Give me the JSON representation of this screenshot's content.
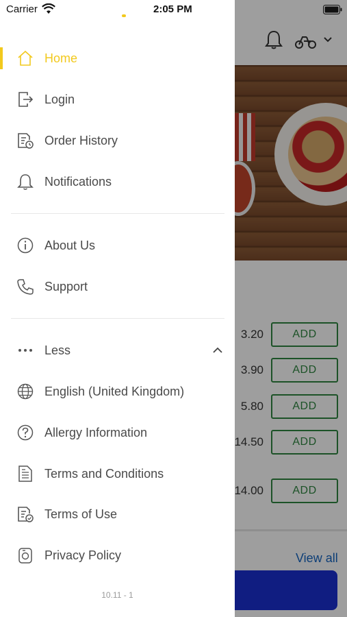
{
  "status_bar": {
    "carrier": "Carrier",
    "time": "2:05 PM"
  },
  "menu": {
    "primary": [
      {
        "label": "Home",
        "icon": "home-icon",
        "active": true
      },
      {
        "label": "Login",
        "icon": "login-icon"
      },
      {
        "label": "Order History",
        "icon": "order-history-icon"
      },
      {
        "label": "Notifications",
        "icon": "bell-icon"
      }
    ],
    "secondary": [
      {
        "label": "About Us",
        "icon": "info-icon"
      },
      {
        "label": "Support",
        "icon": "phone-icon"
      }
    ],
    "more_toggle": {
      "label": "Less",
      "icon": "ellipsis-icon",
      "chevron": "chevron-up-icon"
    },
    "extra": [
      {
        "label": "English (United Kingdom)",
        "icon": "globe-icon"
      },
      {
        "label": "Allergy Information",
        "icon": "question-icon"
      },
      {
        "label": "Terms and Conditions",
        "icon": "document-icon"
      },
      {
        "label": "Terms of Use",
        "icon": "document-check-icon"
      },
      {
        "label": "Privacy Policy",
        "icon": "privacy-icon"
      }
    ],
    "version": "10.11 - 1"
  },
  "background": {
    "prices": [
      "3.20",
      "3.90",
      "5.80",
      "14.50",
      "14.00"
    ],
    "add_label": "ADD",
    "view_all": "View all"
  },
  "colors": {
    "accent": "#f2c91d",
    "add_green": "#2e8540",
    "link_blue": "#1565c0",
    "button_blue": "#1a2fd0"
  }
}
